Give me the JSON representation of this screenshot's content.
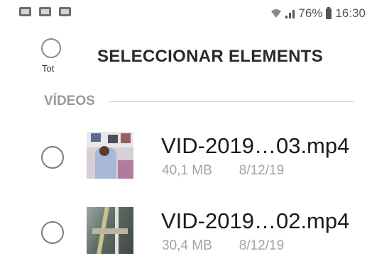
{
  "status_bar": {
    "notification_icons": [
      "gallery-icon",
      "message-icon",
      "image-icon"
    ],
    "battery_percent": "76%",
    "time": "16:30"
  },
  "header": {
    "select_all_label": "Tot",
    "title": "SELECCIONAR ELEMENTS"
  },
  "section": {
    "label": "VÍDEOS"
  },
  "items": [
    {
      "name": "VID-2019…03.mp4",
      "size": "40,1 MB",
      "date": "8/12/19",
      "selected": false
    },
    {
      "name": "VID-2019…02.mp4",
      "size": "30,4 MB",
      "date": "8/12/19",
      "selected": false
    }
  ],
  "colors": {
    "title_text": "#2a2a2a",
    "section_text": "#9a9a9a",
    "meta_text": "#a2a2a2",
    "checkbox_border": "#7c7c7c"
  }
}
